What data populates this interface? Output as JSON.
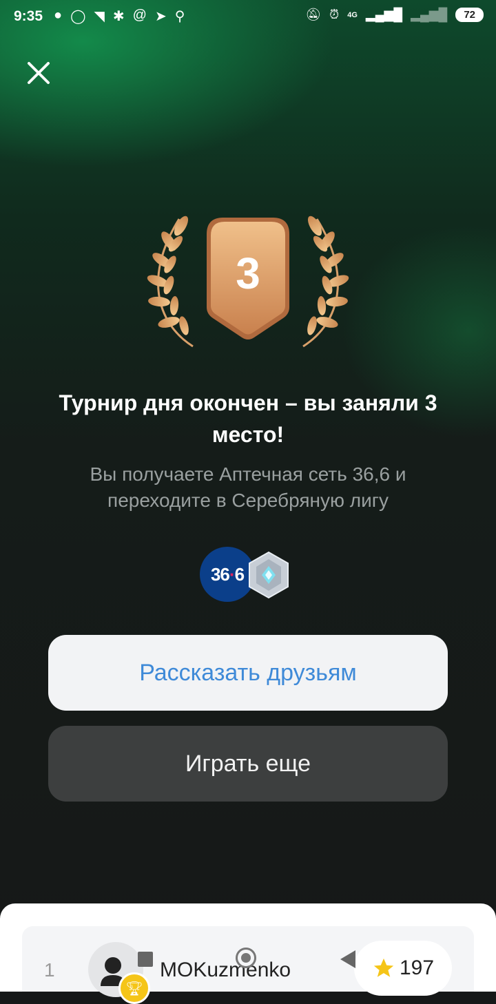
{
  "status_bar": {
    "time": "9:35",
    "battery": "72",
    "network": "4G",
    "left_icons": [
      "notification-icon",
      "whatsapp-icon",
      "rss-icon",
      "bug-icon",
      "at-icon",
      "telegram-icon",
      "search-icon"
    ],
    "right_icons": [
      "mute-icon",
      "alarm-icon",
      "signal-icon",
      "signal-weak-icon",
      "battery-icon"
    ]
  },
  "result": {
    "place": "3",
    "title": "Турнир дня окончен – вы заняли 3 место!",
    "subtitle": "Вы получаете Аптечная сеть 36,6 и переходите в Серебряную лигу",
    "reward_logo_text": "36",
    "reward_logo_dot": "·",
    "reward_logo_text2": "6",
    "medal_color": "#d9955f",
    "accent_color": "#3f8ad8"
  },
  "buttons": {
    "share": "Рассказать друзьям",
    "play_again": "Играть еще"
  },
  "leaderboard": {
    "rows": [
      {
        "rank": "1",
        "name": "MOKuzmenko",
        "score": "197"
      }
    ]
  }
}
